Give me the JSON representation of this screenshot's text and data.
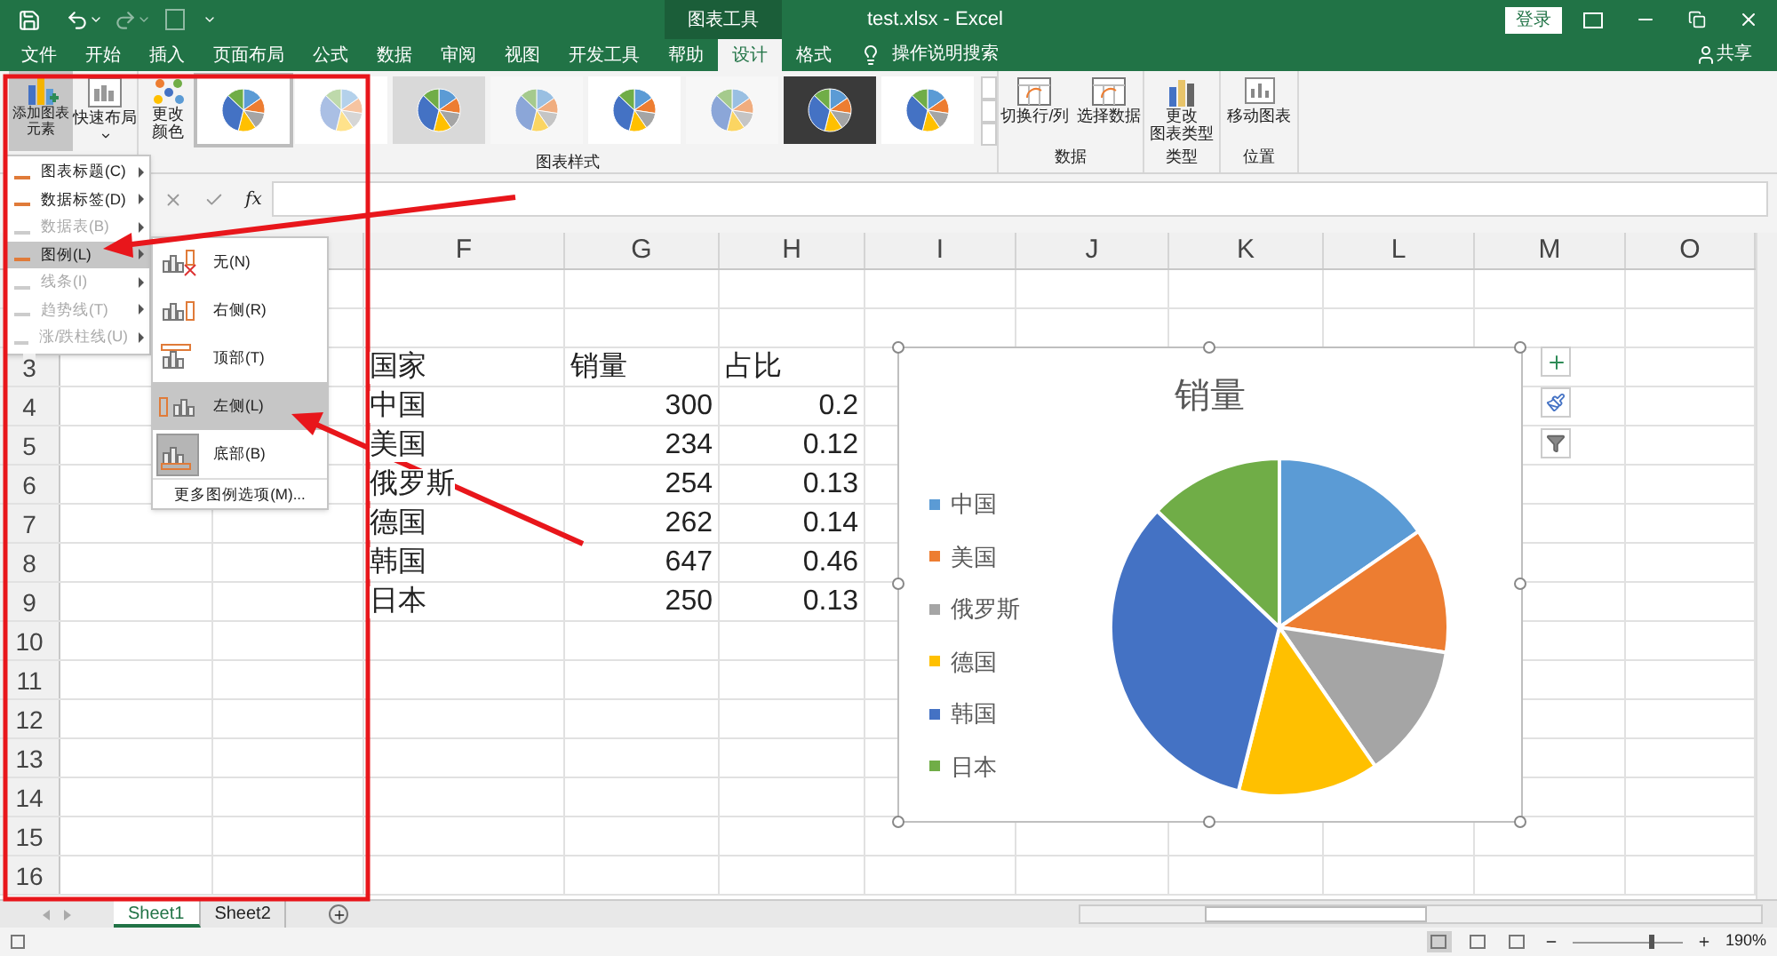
{
  "window": {
    "title": "test.xlsx  -  Excel",
    "context_tab": "图表工具",
    "sign_in": "登录"
  },
  "menu_tabs": [
    {
      "label": "文件",
      "selected": false
    },
    {
      "label": "开始",
      "selected": false
    },
    {
      "label": "插入",
      "selected": false
    },
    {
      "label": "页面布局",
      "selected": false
    },
    {
      "label": "公式",
      "selected": false
    },
    {
      "label": "数据",
      "selected": false
    },
    {
      "label": "审阅",
      "selected": false
    },
    {
      "label": "视图",
      "selected": false
    },
    {
      "label": "开发工具",
      "selected": false
    },
    {
      "label": "帮助",
      "selected": false
    },
    {
      "label": "设计",
      "selected": true
    },
    {
      "label": "格式",
      "selected": false
    }
  ],
  "tell_me": "操作说明搜索",
  "share": "共享",
  "ribbon": {
    "add_element": [
      "添加图表",
      "元素"
    ],
    "quick_layout": "快速布局",
    "change_colors": [
      "更改",
      "颜色"
    ],
    "styles_label": "图表样式",
    "styles": [
      {
        "kind": "plain",
        "selected": true
      },
      {
        "kind": "pattern",
        "selected": false
      },
      {
        "kind": "shaded",
        "selected": false
      },
      {
        "kind": "light",
        "selected": false
      },
      {
        "kind": "plain",
        "selected": false
      },
      {
        "kind": "light",
        "selected": false
      },
      {
        "kind": "dark",
        "selected": false
      },
      {
        "kind": "plain",
        "selected": false
      }
    ],
    "data_buttons": [
      "切换行/列",
      "选择数据"
    ],
    "data_label": "数据",
    "type_button": [
      "更改",
      "图表类型"
    ],
    "type_label": "类型",
    "move_button": "移动图表",
    "location_label": "位置"
  },
  "formula_bar": {
    "fx": "fx"
  },
  "columns": [
    "F",
    "G",
    "H",
    "I",
    "J",
    "K",
    "L",
    "M",
    "O"
  ],
  "rows": [
    {
      "number": "3",
      "cells": [
        {
          "kind": "text",
          "text": "国家"
        },
        {
          "kind": "text",
          "text": "销量"
        },
        {
          "kind": "text",
          "text": "占比"
        }
      ]
    },
    {
      "number": "4",
      "cells": [
        {
          "kind": "text",
          "text": "中国"
        },
        {
          "kind": "number",
          "text": "300"
        },
        {
          "kind": "number",
          "text": "0.2"
        }
      ]
    },
    {
      "number": "5",
      "cells": [
        {
          "kind": "text",
          "text": "美国"
        },
        {
          "kind": "number",
          "text": "234"
        },
        {
          "kind": "number",
          "text": "0.12"
        }
      ]
    },
    {
      "number": "6",
      "cells": [
        {
          "kind": "text",
          "text": "俄罗斯"
        },
        {
          "kind": "number",
          "text": "254"
        },
        {
          "kind": "number",
          "text": "0.13"
        }
      ]
    },
    {
      "number": "7",
      "cells": [
        {
          "kind": "text",
          "text": "德国"
        },
        {
          "kind": "number",
          "text": "262"
        },
        {
          "kind": "number",
          "text": "0.14"
        }
      ]
    },
    {
      "number": "8",
      "cells": [
        {
          "kind": "text",
          "text": "韩国"
        },
        {
          "kind": "number",
          "text": "647"
        },
        {
          "kind": "number",
          "text": "0.46"
        }
      ]
    },
    {
      "number": "9",
      "cells": [
        {
          "kind": "text",
          "text": "日本"
        },
        {
          "kind": "number",
          "text": "250"
        },
        {
          "kind": "number",
          "text": "0.13"
        }
      ]
    },
    {
      "number": "10",
      "cells": []
    },
    {
      "number": "11",
      "cells": []
    },
    {
      "number": "12",
      "cells": []
    },
    {
      "number": "13",
      "cells": []
    },
    {
      "number": "14",
      "cells": []
    },
    {
      "number": "15",
      "cells": []
    },
    {
      "number": "16",
      "cells": []
    }
  ],
  "chart": {
    "chart_data": {
      "type": "pie",
      "title": "销量",
      "categories": [
        "中国",
        "美国",
        "俄罗斯",
        "德国",
        "韩国",
        "日本"
      ],
      "values": [
        15.4,
        12.0,
        13.0,
        13.5,
        33.2,
        12.9
      ],
      "colors": [
        "#5b9bd5",
        "#ed7d31",
        "#a5a5a5",
        "#ffc000",
        "#4472c4",
        "#70ad47"
      ]
    }
  },
  "element_menu": [
    {
      "label": "图表标题(C)",
      "disabled": false,
      "selected": false
    },
    {
      "label": "数据标签(D)",
      "disabled": false,
      "selected": false
    },
    {
      "label": "数据表(B)",
      "disabled": true,
      "selected": false
    },
    {
      "label": "图例(L)",
      "disabled": false,
      "selected": true
    },
    {
      "label": "线条(I)",
      "disabled": true,
      "selected": false
    },
    {
      "label": "趋势线(T)",
      "disabled": true,
      "selected": false
    },
    {
      "label": "涨/跌柱线(U)",
      "disabled": true,
      "selected": false
    }
  ],
  "legend_menu": {
    "items": [
      {
        "label": "无(N)",
        "kind": "none",
        "hovered": false,
        "selected": false
      },
      {
        "label": "右侧(R)",
        "kind": "right",
        "hovered": false,
        "selected": false
      },
      {
        "label": "顶部(T)",
        "kind": "top",
        "hovered": false,
        "selected": false
      },
      {
        "label": "左侧(L)",
        "kind": "left",
        "hovered": true,
        "selected": false
      },
      {
        "label": "底部(B)",
        "kind": "bottom",
        "hovered": false,
        "selected": true
      }
    ],
    "more": "更多图例选项(M)..."
  },
  "sheets": [
    {
      "label": "Sheet1",
      "selected": true
    },
    {
      "label": "Sheet2",
      "selected": false
    }
  ],
  "status_bar": {
    "zoom": "190%",
    "zoom_slider": {
      "level": 0.7
    },
    "views": [
      {
        "selected": true
      },
      {
        "selected": false
      },
      {
        "selected": false
      }
    ]
  }
}
